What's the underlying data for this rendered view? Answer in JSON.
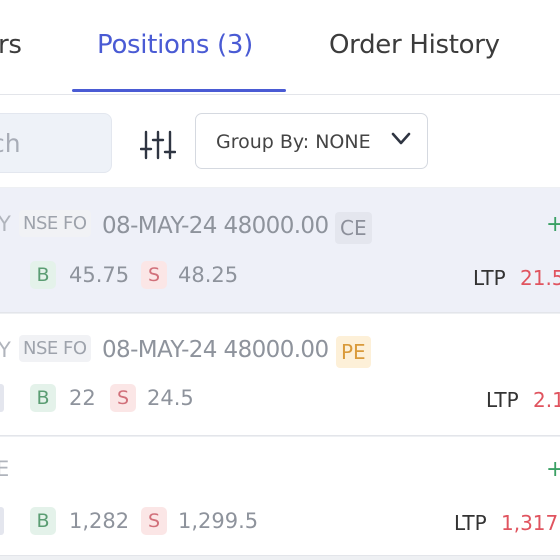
{
  "tabs": {
    "left_partial": "rs",
    "positions": "Positions (3)",
    "order_history": "Order History"
  },
  "toolbar": {
    "search_placeholder": "ch",
    "group_by_label": "Group By:",
    "group_by_value": "NONE"
  },
  "positions": [
    {
      "symbol_fragment": "Y",
      "exchange": "NSE FO",
      "contract": "08-MAY-24 48000.00",
      "option_type": "CE",
      "buy_price": "45.75",
      "sell_price": "48.25",
      "ltp_label": "LTP",
      "ltp": "21.5",
      "pnl_sign": "+"
    },
    {
      "symbol_fragment": "Y",
      "exchange": "NSE FO",
      "contract": "08-MAY-24 48000.00",
      "option_type": "PE",
      "buy_price": "22",
      "sell_price": "24.5",
      "ltp_label": "LTP",
      "ltp": "2.1"
    },
    {
      "symbol_fragment": "E",
      "buy_price": "1,282",
      "sell_price": "1,299.5",
      "ltp_label": "LTP",
      "ltp": "1,317.",
      "pnl_sign": "+"
    }
  ],
  "labels": {
    "buy": "B",
    "sell": "S"
  },
  "colors": {
    "accent": "#4a5bd4",
    "buy": "#5b9d73",
    "sell": "#d1707a",
    "ltp": "#e0545f",
    "profit": "#3aa064"
  },
  "icons": {
    "filter": "sliders-icon",
    "group_by_chevron": "chevron-down-icon"
  }
}
